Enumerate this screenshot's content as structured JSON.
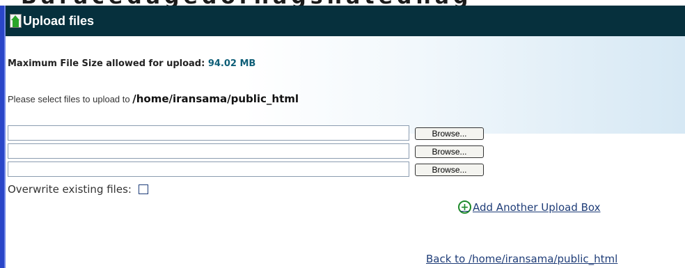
{
  "header": {
    "title": "Upload files",
    "icon": "upload-icon"
  },
  "max_size": {
    "label": "Maximum File Size allowed for upload: ",
    "value": "94.02 MB"
  },
  "select_line": {
    "text": "Please select files to upload to ",
    "path": "/home/iransama/public_html"
  },
  "uploads": [
    {
      "value": "",
      "browse_label": "Browse..."
    },
    {
      "value": "",
      "browse_label": "Browse..."
    },
    {
      "value": "",
      "browse_label": "Browse..."
    }
  ],
  "overwrite": {
    "label": "Overwrite existing files:",
    "checked": false
  },
  "add_box": {
    "label": " Add Another Upload Box"
  },
  "back_link": {
    "label": "Back to /home/iransama/public_html"
  },
  "colors": {
    "header_bg": "#06303d",
    "left_bar": "#2a46c8",
    "accent_value": "#0f5f78",
    "link": "#1f3d78",
    "plus_green": "#1e8a2a"
  }
}
